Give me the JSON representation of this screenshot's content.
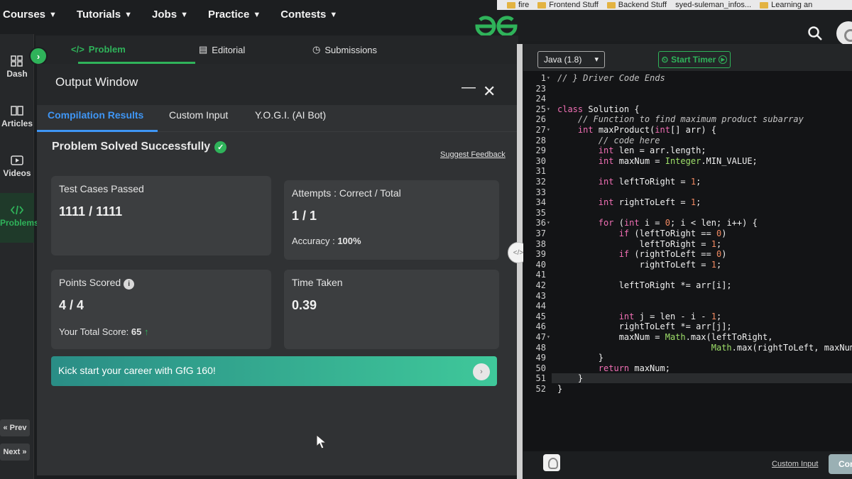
{
  "nav": {
    "links": [
      "Courses",
      "Tutorials",
      "Jobs",
      "Practice",
      "Contests"
    ],
    "bookmarks": [
      "fire",
      "Frontend Stuff",
      "Backend Stuff",
      "syed-suleman_infos...",
      "Learning an"
    ]
  },
  "rail": {
    "items": [
      {
        "label": "Dash",
        "icon": "dashboard-icon"
      },
      {
        "label": "Articles",
        "icon": "book-icon"
      },
      {
        "label": "Videos",
        "icon": "video-icon"
      },
      {
        "label": "Problems",
        "icon": "code-icon"
      }
    ],
    "prev": "« Prev",
    "next": "Next »"
  },
  "problem_tabs": {
    "problem": "Problem",
    "editorial": "Editorial",
    "submissions": "Submissions"
  },
  "output": {
    "title": "Output Window",
    "tabs": [
      "Compilation Results",
      "Custom Input",
      "Y.O.G.I. (AI Bot)"
    ],
    "status": "Problem Solved Successfully",
    "feedback": "Suggest Feedback",
    "test_cases_label": "Test Cases Passed",
    "test_cases_value": "1111 / 1111",
    "attempts_label": "Attempts : Correct / Total",
    "attempts_value": "1 / 1",
    "accuracy_label": "Accuracy :",
    "accuracy_value": "100%",
    "points_label": "Points Scored",
    "points_value": "4 / 4",
    "total_score_label": "Your Total Score:",
    "total_score_value": "65",
    "time_label": "Time Taken",
    "time_value": "0.39",
    "banner": "Kick start your career with GfG 160!"
  },
  "editor": {
    "language": "Java (1.8)",
    "timer": "Start Timer",
    "custom_input": "Custom Input",
    "compile": "Com"
  },
  "code_lines": [
    {
      "n": "1",
      "t": "// } Driver Code Ends"
    },
    {
      "n": "23",
      "t": ""
    },
    {
      "n": "24",
      "t": ""
    },
    {
      "n": "25",
      "t": "class Solution {"
    },
    {
      "n": "26",
      "t": "    // Function to find maximum product subarray"
    },
    {
      "n": "27",
      "t": "    int maxProduct(int[] arr) {"
    },
    {
      "n": "28",
      "t": "        // code here"
    },
    {
      "n": "29",
      "t": "        int len = arr.length;"
    },
    {
      "n": "30",
      "t": "        int maxNum = Integer.MIN_VALUE;"
    },
    {
      "n": "31",
      "t": ""
    },
    {
      "n": "32",
      "t": "        int leftToRight = 1;"
    },
    {
      "n": "33",
      "t": ""
    },
    {
      "n": "34",
      "t": "        int rightToLeft = 1;"
    },
    {
      "n": "35",
      "t": ""
    },
    {
      "n": "36",
      "t": "        for (int i = 0; i < len; i++) {"
    },
    {
      "n": "37",
      "t": "            if (leftToRight == 0)"
    },
    {
      "n": "38",
      "t": "                leftToRight = 1;"
    },
    {
      "n": "39",
      "t": "            if (rightToLeft == 0)"
    },
    {
      "n": "40",
      "t": "                rightToLeft = 1;"
    },
    {
      "n": "41",
      "t": ""
    },
    {
      "n": "42",
      "t": "            leftToRight *= arr[i];"
    },
    {
      "n": "43",
      "t": ""
    },
    {
      "n": "44",
      "t": ""
    },
    {
      "n": "45",
      "t": "            int j = len - i - 1;"
    },
    {
      "n": "46",
      "t": "            rightToLeft *= arr[j];"
    },
    {
      "n": "47",
      "t": "            maxNum = Math.max(leftToRight,"
    },
    {
      "n": "48",
      "t": "                              Math.max(rightToLeft, maxNum));"
    },
    {
      "n": "49",
      "t": "        }"
    },
    {
      "n": "50",
      "t": "        return maxNum;"
    },
    {
      "n": "51",
      "t": "    }"
    },
    {
      "n": "52",
      "t": "}"
    }
  ],
  "colors": {
    "accent_green": "#2fb35a",
    "tab_blue": "#3f96f5",
    "banner_start": "#2a8d86",
    "banner_end": "#3fc89a"
  }
}
